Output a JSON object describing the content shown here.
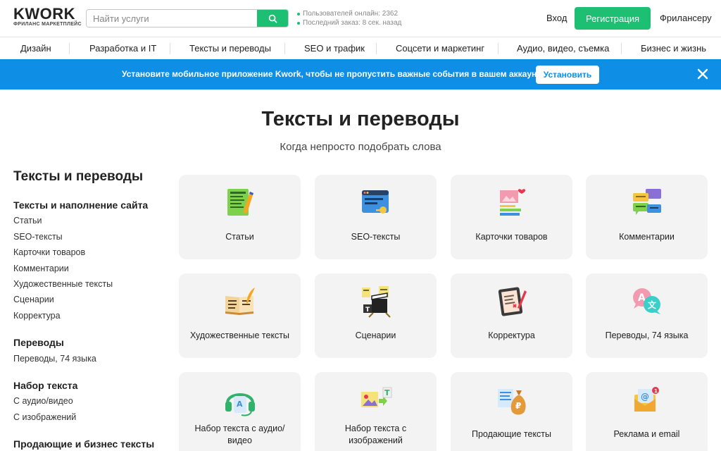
{
  "header": {
    "logo_main": "KWORK",
    "logo_sub": "ФРИЛАНС МАРКЕТПЛЕЙС",
    "search_placeholder": "Найти услуги",
    "stats_online": "Пользователей онлайн: 2362",
    "stats_last_order": "Последний заказ: 8 сек. назад",
    "login_label": "Вход",
    "register_label": "Регистрация",
    "freelancer_label": "Фрилансеру"
  },
  "nav": {
    "items": [
      "Дизайн",
      "Разработка и IT",
      "Тексты и переводы",
      "SEO и трафик",
      "Соцсети и маркетинг",
      "Аудио, видео, съемка",
      "Бизнес и жизнь"
    ]
  },
  "banner": {
    "text": "Установите мобильное приложение Kwork, чтобы не пропустить важные события в вашем аккаунте!",
    "button_label": "Установить"
  },
  "page": {
    "title": "Тексты и переводы",
    "subtitle": "Когда непросто подобрать слова"
  },
  "sidebar": {
    "title": "Тексты и переводы",
    "groups": [
      {
        "title": "Тексты и наполнение сайта",
        "links": [
          "Статьи",
          "SEO-тексты",
          "Карточки товаров",
          "Комментарии",
          "Художественные тексты",
          "Сценарии",
          "Корректура"
        ]
      },
      {
        "title": "Переводы",
        "links": [
          "Переводы, 74 языка"
        ]
      },
      {
        "title": "Набор текста",
        "links": [
          "С аудио/видео",
          "С изображений"
        ]
      },
      {
        "title": "Продающие и бизнес тексты",
        "links": []
      }
    ]
  },
  "cards": [
    {
      "label": "Статьи",
      "icon": "notepad-pencil-icon"
    },
    {
      "label": "SEO-тексты",
      "icon": "browser-key-icon"
    },
    {
      "label": "Карточки товаров",
      "icon": "product-card-icon"
    },
    {
      "label": "Комментарии",
      "icon": "chat-bubbles-icon"
    },
    {
      "label": "Художественные тексты",
      "icon": "open-book-quill-icon"
    },
    {
      "label": "Сценарии",
      "icon": "clapperboard-icon"
    },
    {
      "label": "Корректура",
      "icon": "tablet-correction-icon"
    },
    {
      "label": "Переводы, 74 языка",
      "icon": "translate-bubbles-icon"
    },
    {
      "label": "Набор текста с аудио/видео",
      "icon": "headphones-icon"
    },
    {
      "label": "Набор текста с изображений",
      "icon": "image-to-text-icon"
    },
    {
      "label": "Продающие тексты",
      "icon": "money-bag-icon"
    },
    {
      "label": "Реклама и email",
      "icon": "megaphone-mail-icon"
    }
  ],
  "colors": {
    "brand_green": "#1dbf73",
    "banner_blue": "#0e8fe5",
    "card_bg": "#f3f3f3"
  }
}
